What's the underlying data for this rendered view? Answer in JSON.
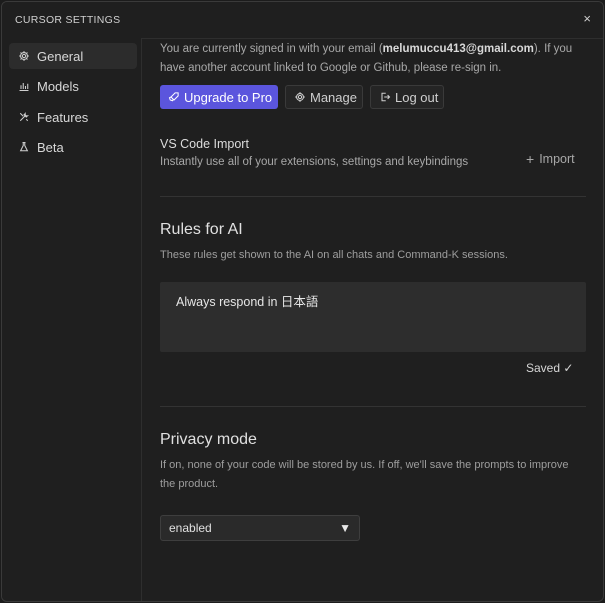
{
  "window": {
    "title": "CURSOR SETTINGS",
    "close_glyph": "×"
  },
  "sidebar": {
    "items": [
      {
        "label": "General",
        "icon": "gear-icon",
        "active": true
      },
      {
        "label": "Models",
        "icon": "bar-chart-icon",
        "active": false
      },
      {
        "label": "Features",
        "icon": "tools-icon",
        "active": false
      },
      {
        "label": "Beta",
        "icon": "flask-icon",
        "active": false
      }
    ]
  },
  "account": {
    "signin_prefix": "You are currently signed in with your email (",
    "email": "melumuccu413@gmail.com",
    "signin_suffix": "). If you have another account linked to Google or Github, please re-sign in.",
    "upgrade_label": "Upgrade to Pro",
    "manage_label": "Manage",
    "logout_label": "Log out"
  },
  "vscode_import": {
    "title": "VS Code Import",
    "description": "Instantly use all of your extensions, settings and keybindings",
    "import_label": "Import",
    "import_glyph": "+"
  },
  "rules": {
    "title": "Rules for AI",
    "description": "These rules get shown to the AI on all chats and Command-K sessions.",
    "value": "Always respond in 日本語",
    "saved_label": "Saved ✓"
  },
  "privacy": {
    "title": "Privacy mode",
    "description": "If on, none of your code will be stored by us. If off, we'll save the prompts to improve the product.",
    "selected": "enabled",
    "caret": "▼"
  },
  "colors": {
    "accent": "#5b55dd",
    "background": "#1f1f1f",
    "panel": "#2d2d2d"
  }
}
